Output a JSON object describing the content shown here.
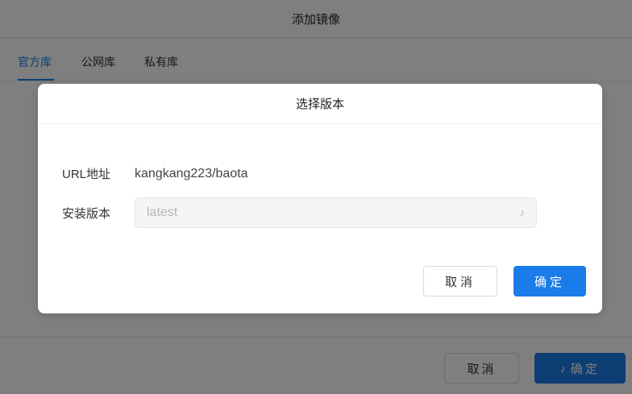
{
  "background": {
    "title": "添加镜像",
    "tabs": [
      {
        "label": "官方库",
        "active": true
      },
      {
        "label": "公网库",
        "active": false
      },
      {
        "label": "私有库",
        "active": false
      }
    ],
    "footer": {
      "cancel_label": "取消",
      "confirm_label": "确定",
      "confirm_icon": "loading-icon"
    }
  },
  "modal": {
    "title": "选择版本",
    "url_label": "URL地址",
    "url_value": "kangkang223/baota",
    "version_label": "安装版本",
    "version_placeholder": "latest",
    "version_icon": "loading-icon",
    "cancel_label": "取消",
    "confirm_label": "确定"
  },
  "colors": {
    "accent": "#1a7ce8",
    "overlay": "rgba(0,0,0,0.5)"
  }
}
